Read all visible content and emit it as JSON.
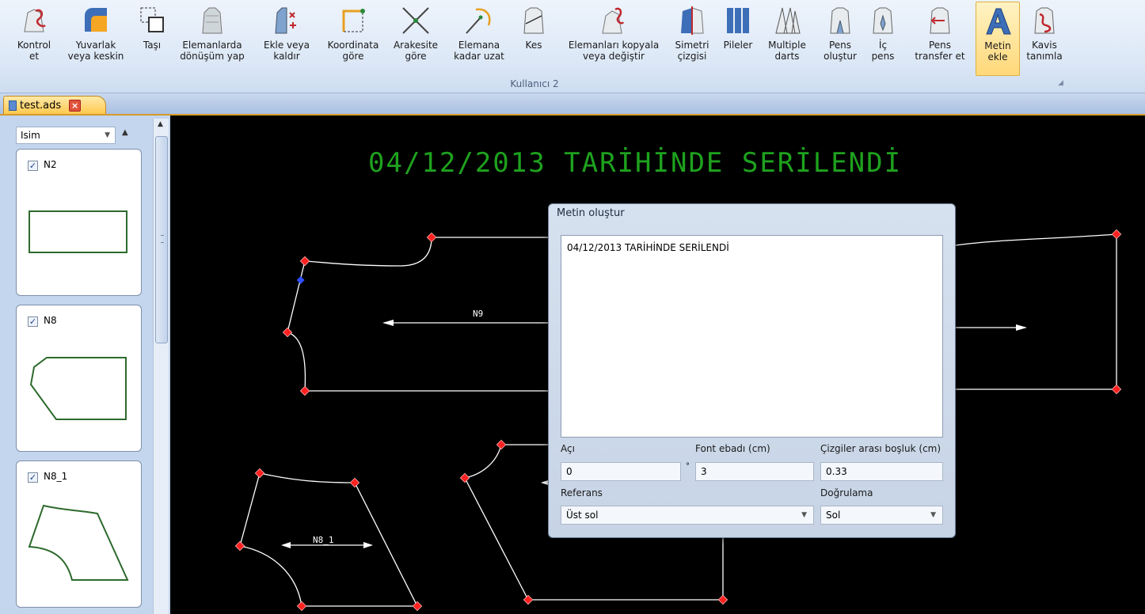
{
  "ribbon": {
    "buttons": [
      {
        "id": "kontrol-et",
        "label": "Kontrol\net"
      },
      {
        "id": "yuvarlak",
        "label": "Yuvarlak\nveya keskin"
      },
      {
        "id": "tasi",
        "label": "Taşı"
      },
      {
        "id": "donusum",
        "label": "Elemanlarda\ndönüşüm yap"
      },
      {
        "id": "ekle-kaldir",
        "label": "Ekle veya\nkaldır"
      },
      {
        "id": "koordinata",
        "label": "Koordinata\ngöre"
      },
      {
        "id": "arakesite",
        "label": "Arakesite\ngöre"
      },
      {
        "id": "elemana-uzat",
        "label": "Elemana\nkadar uzat"
      },
      {
        "id": "kes",
        "label": "Kes"
      },
      {
        "id": "kopyala",
        "label": "Elemanları kopyala\nveya değiştir"
      },
      {
        "id": "simetri",
        "label": "Simetri\nçizgisi"
      },
      {
        "id": "pileler",
        "label": "Pileler"
      },
      {
        "id": "multiple-darts",
        "label": "Multiple\ndarts"
      },
      {
        "id": "pens-olustur",
        "label": "Pens\noluştur"
      },
      {
        "id": "ic-pens",
        "label": "İç\npens"
      },
      {
        "id": "pens-transfer",
        "label": "Pens\ntransfer et"
      },
      {
        "id": "metin-ekle",
        "label": "Metin\nekle"
      },
      {
        "id": "kavis",
        "label": "Kavis\ntanımla"
      }
    ],
    "group_label": "Kullanıcı 2"
  },
  "tab": {
    "label": "test.ads",
    "close": "×"
  },
  "panel": {
    "select_value": "Isim",
    "cards": [
      {
        "name": "N2",
        "checked": "✓"
      },
      {
        "name": "N8",
        "checked": "✓"
      },
      {
        "name": "N8_1",
        "checked": "✓"
      }
    ]
  },
  "canvas": {
    "title": "04/12/2013 TARİHİNDE SERİLENDİ",
    "labels": {
      "n9": "N9",
      "n8_1": "N8_1"
    }
  },
  "dialog": {
    "title": "Metin oluştur",
    "text": "04/12/2013 TARİHİNDE SERİLENDİ",
    "angle_label": "Açı",
    "angle_value": "0",
    "degree_symbol": "°",
    "font_label": "Font ebadı (cm)",
    "font_value": "3",
    "spacing_label": "Çizgiler arası boşluk (cm)",
    "spacing_value": "0.33",
    "reference_label": "Referans",
    "reference_value": "Üst sol",
    "alignment_label": "Doğrulama",
    "alignment_value": "Sol"
  },
  "colors": {
    "accent": "#ffd879",
    "canvas_text": "#1ea21e",
    "pattern_line": "#ffffff",
    "node": "#ff2020"
  }
}
